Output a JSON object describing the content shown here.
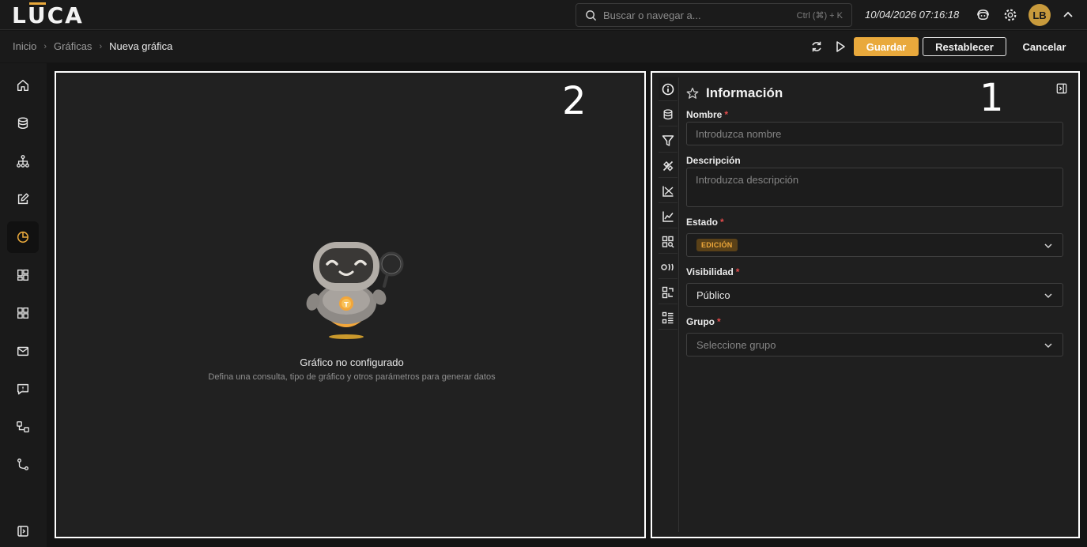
{
  "app": {
    "logo_text": "LUCA",
    "brand_color": "#e9a93c"
  },
  "header": {
    "search_placeholder": "Buscar o navegar a...",
    "search_shortcut": "Ctrl (⌘) + K",
    "datetime": "10/04/2026 07:16:18",
    "avatar_initials": "LB"
  },
  "breadcrumb": {
    "items": [
      "Inicio",
      "Gráficas"
    ],
    "current": "Nueva gráfica"
  },
  "toolbar": {
    "save_label": "Guardar",
    "reset_label": "Restablecer",
    "cancel_label": "Cancelar"
  },
  "sidebar": {
    "items": [
      {
        "icon": "home-icon"
      },
      {
        "icon": "database-icon"
      },
      {
        "icon": "hierarchy-icon"
      },
      {
        "icon": "edit-icon"
      },
      {
        "icon": "pie-chart-icon",
        "active": true
      },
      {
        "icon": "dashboard-icon"
      },
      {
        "icon": "grid-icon"
      },
      {
        "icon": "mail-icon"
      },
      {
        "icon": "chat-icon"
      },
      {
        "icon": "flow-icon"
      },
      {
        "icon": "git-icon"
      },
      {
        "icon": "expand-panel-icon"
      }
    ]
  },
  "regions": {
    "chart_number": "2",
    "config_number": "1"
  },
  "chart_area": {
    "empty_title": "Gráfico no configurado",
    "empty_subtitle": "Defina una consulta, tipo de gráfico y otros parámetros para generar datos"
  },
  "config": {
    "title": "Información",
    "tabs": [
      "info-icon",
      "database-icon",
      "filter-icon",
      "tools-icon",
      "axis-icon",
      "line-chart-icon",
      "widget-search-icon",
      "variables-icon",
      "swap-icon",
      "list-icon"
    ],
    "fields": {
      "nombre": {
        "label": "Nombre",
        "placeholder": "Introduzca nombre"
      },
      "descripcion": {
        "label": "Descripción",
        "placeholder": "Introduzca descripción"
      },
      "estado": {
        "label": "Estado",
        "value": "EDICIÓN"
      },
      "visibilidad": {
        "label": "Visibilidad",
        "value": "Público"
      },
      "grupo": {
        "label": "Grupo",
        "placeholder": "Seleccione grupo"
      }
    },
    "required_mark": "*"
  }
}
